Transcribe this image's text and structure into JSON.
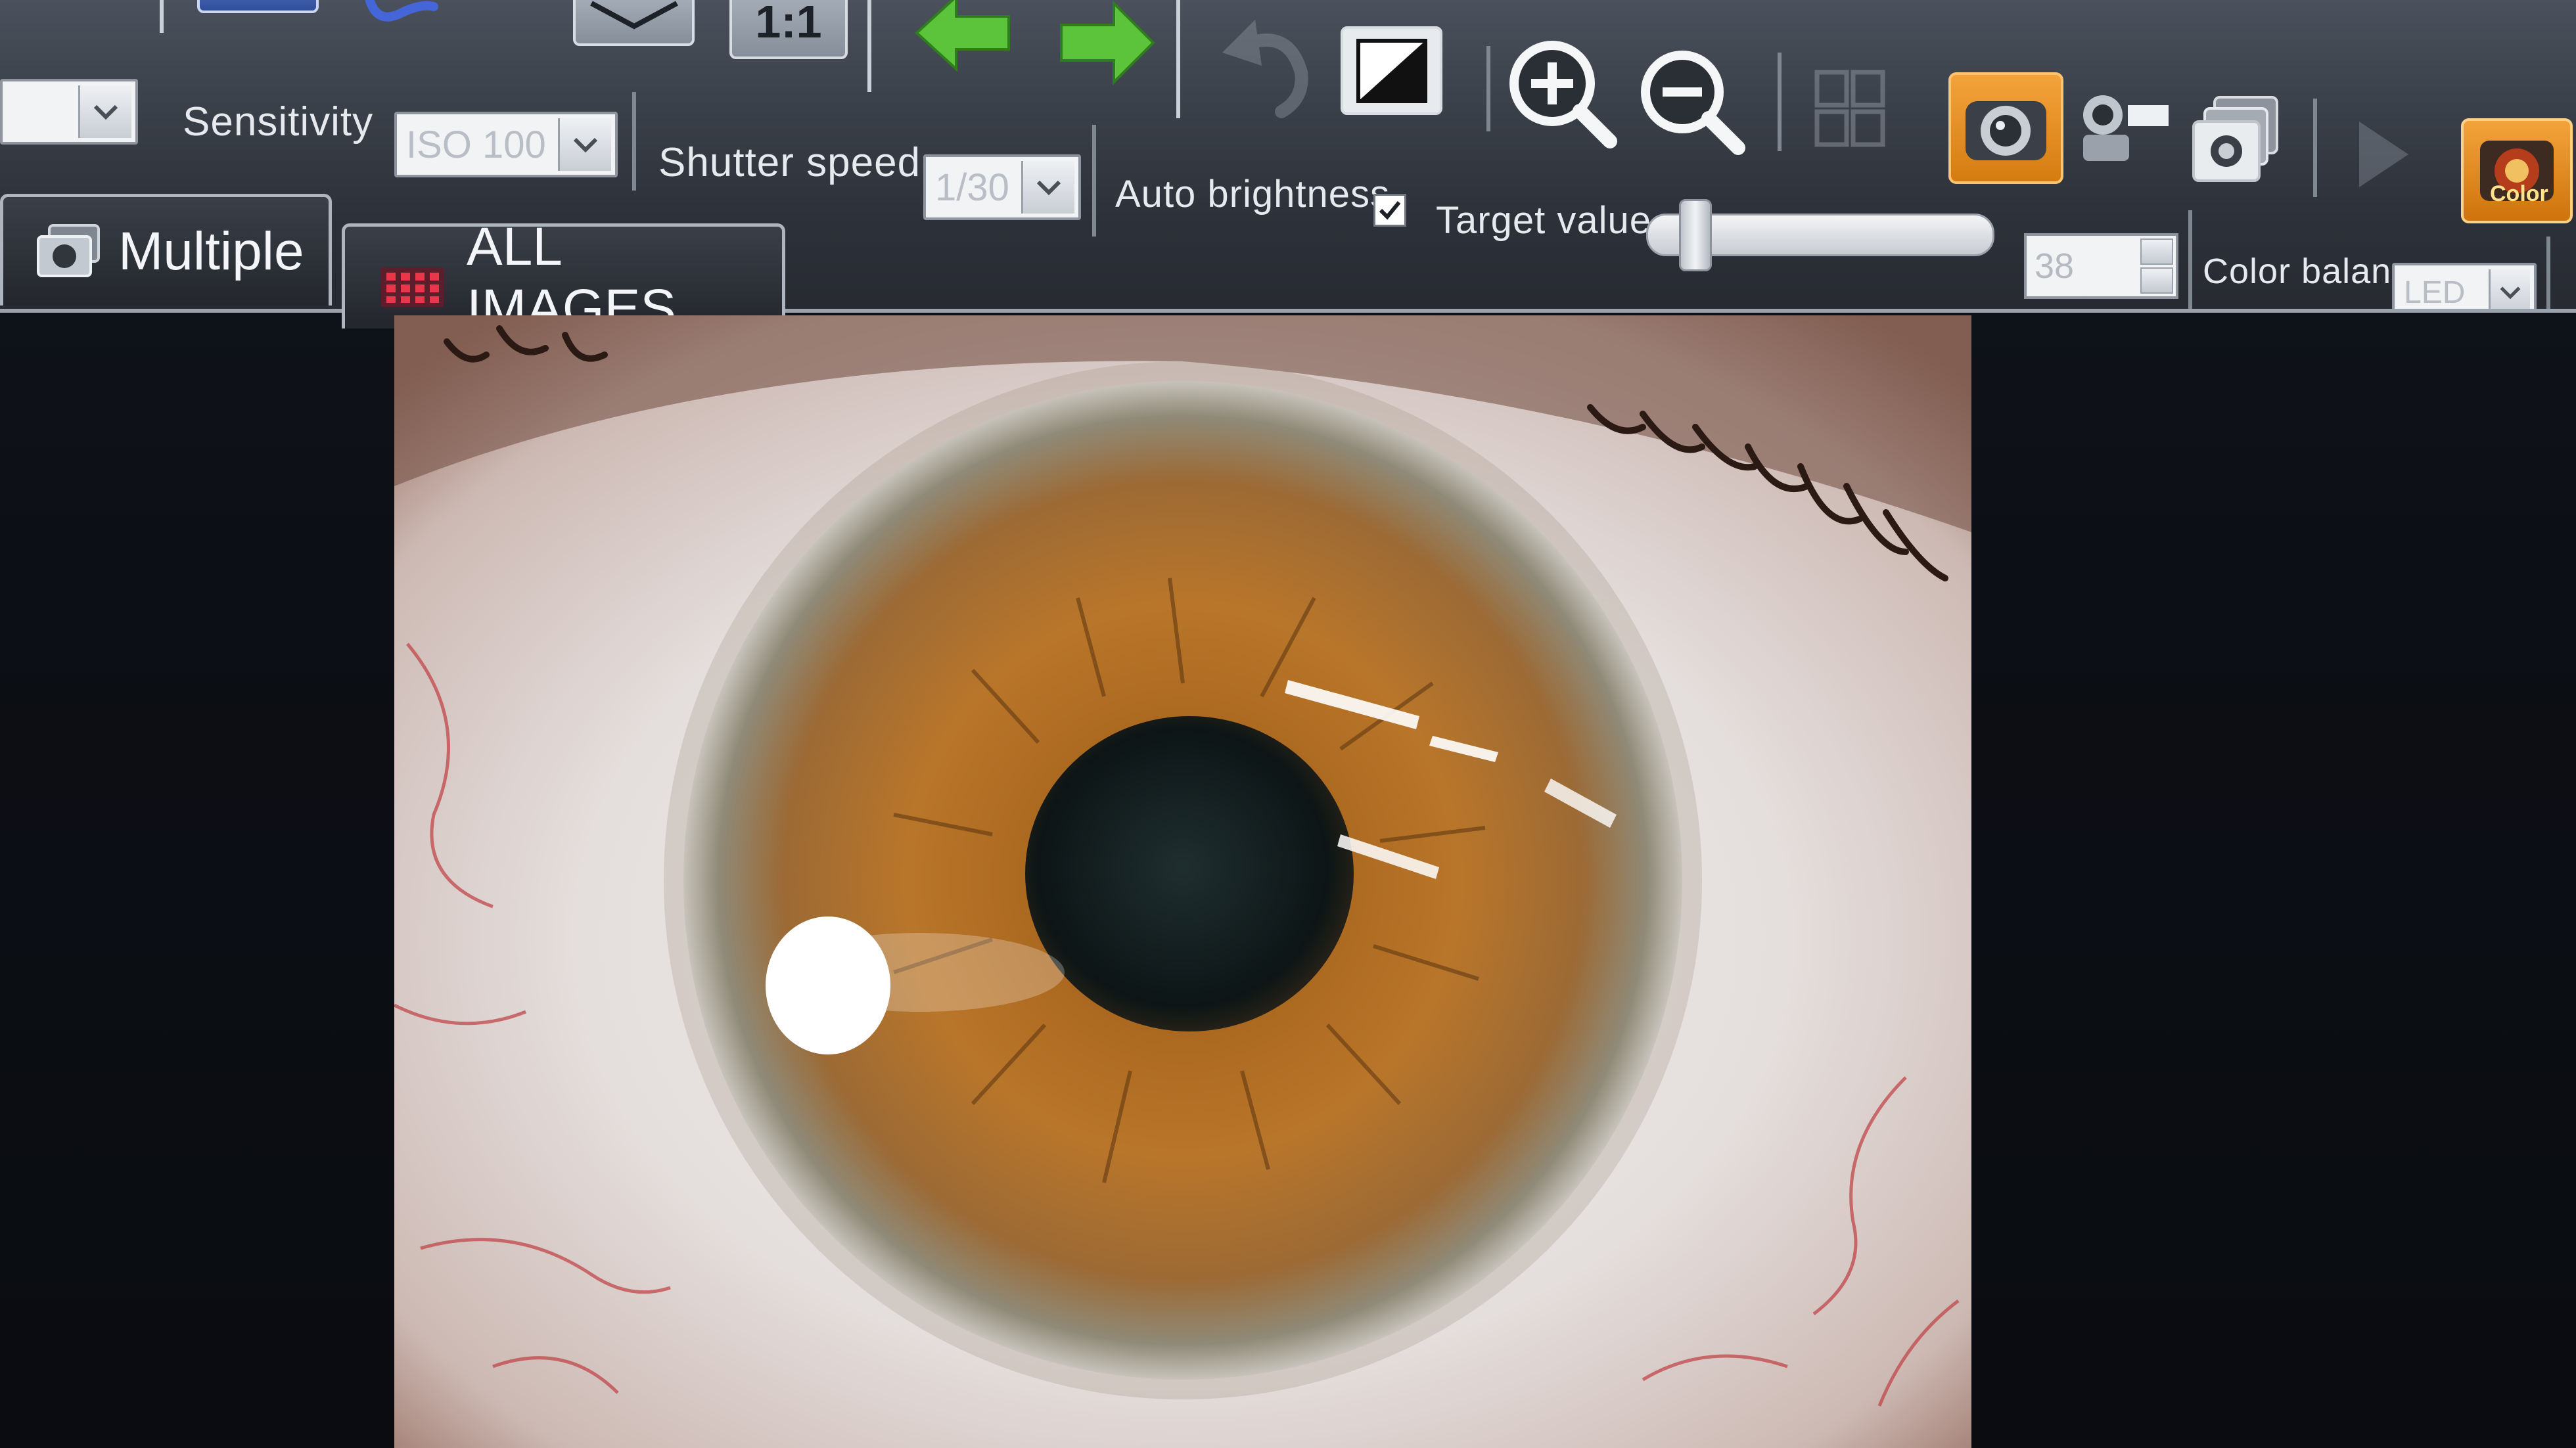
{
  "toolbar": {
    "sensitivity_label": "Sensitivity",
    "sensitivity_value": "ISO 100",
    "shutter_label": "Shutter speed",
    "shutter_value": "1/30",
    "auto_brightness_label": "Auto brightness",
    "auto_brightness_checked": true,
    "target_label": "Target value",
    "target_value": "38",
    "target_level_fraction": 0.1,
    "color_balance_label": "Color balance",
    "color_balance_value": "LED",
    "one_to_one_label": "1:1",
    "color_button_label": "Color"
  },
  "tabs": [
    {
      "label": "Multiple",
      "icon": "camera-icon"
    },
    {
      "label": "ALL IMAGES",
      "icon": "grid-icon"
    }
  ],
  "colors": {
    "toolbar_bg": "#2d3139",
    "accent_orange": "#e58a17",
    "arrow_green": "#5cc43a",
    "iris_brown": "#a0621f"
  }
}
